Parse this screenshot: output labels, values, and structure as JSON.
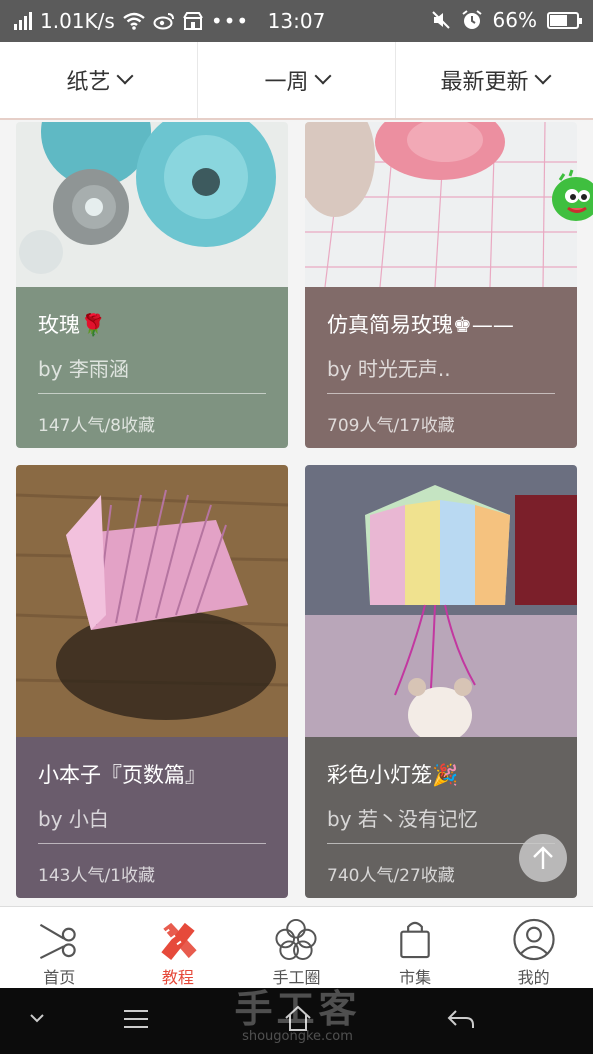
{
  "status_bar": {
    "speed": "1.01K/s",
    "time": "13:07",
    "battery": "66%",
    "battery_level": 0.66
  },
  "filters": [
    {
      "label": "纸艺"
    },
    {
      "label": "一周"
    },
    {
      "label": "最新更新"
    }
  ],
  "cards": [
    {
      "title": "玫瑰🌹",
      "author": "by 李雨涵",
      "stats": "147人气/8收藏",
      "color": "#7f9381"
    },
    {
      "title": "仿真简易玫瑰♚——",
      "author": "by 时光无声..",
      "stats": "709人气/17收藏",
      "color": "#816b69"
    },
    {
      "title": "小本子『页数篇』",
      "author": "by 小白",
      "stats": "143人气/1收藏",
      "color": "#6a5c6c"
    },
    {
      "title": "彩色小灯笼🎉",
      "author": "by 若丶没有记忆",
      "stats": "740人气/27收藏",
      "color": "#656260"
    }
  ],
  "tabs": [
    {
      "label": "首页",
      "icon": "scissors-icon"
    },
    {
      "label": "教程",
      "icon": "pencil-ruler-icon",
      "active": true
    },
    {
      "label": "手工圈",
      "icon": "flower-icon"
    },
    {
      "label": "市集",
      "icon": "shopping-bag-icon"
    },
    {
      "label": "我的",
      "icon": "user-icon"
    }
  ],
  "watermark": {
    "title": "手工客",
    "url": "shougongke.com"
  },
  "colors": {
    "accent": "#e64a3b",
    "status_bar": "#5b5b5b",
    "nav_bar": "#0c0c0c"
  }
}
